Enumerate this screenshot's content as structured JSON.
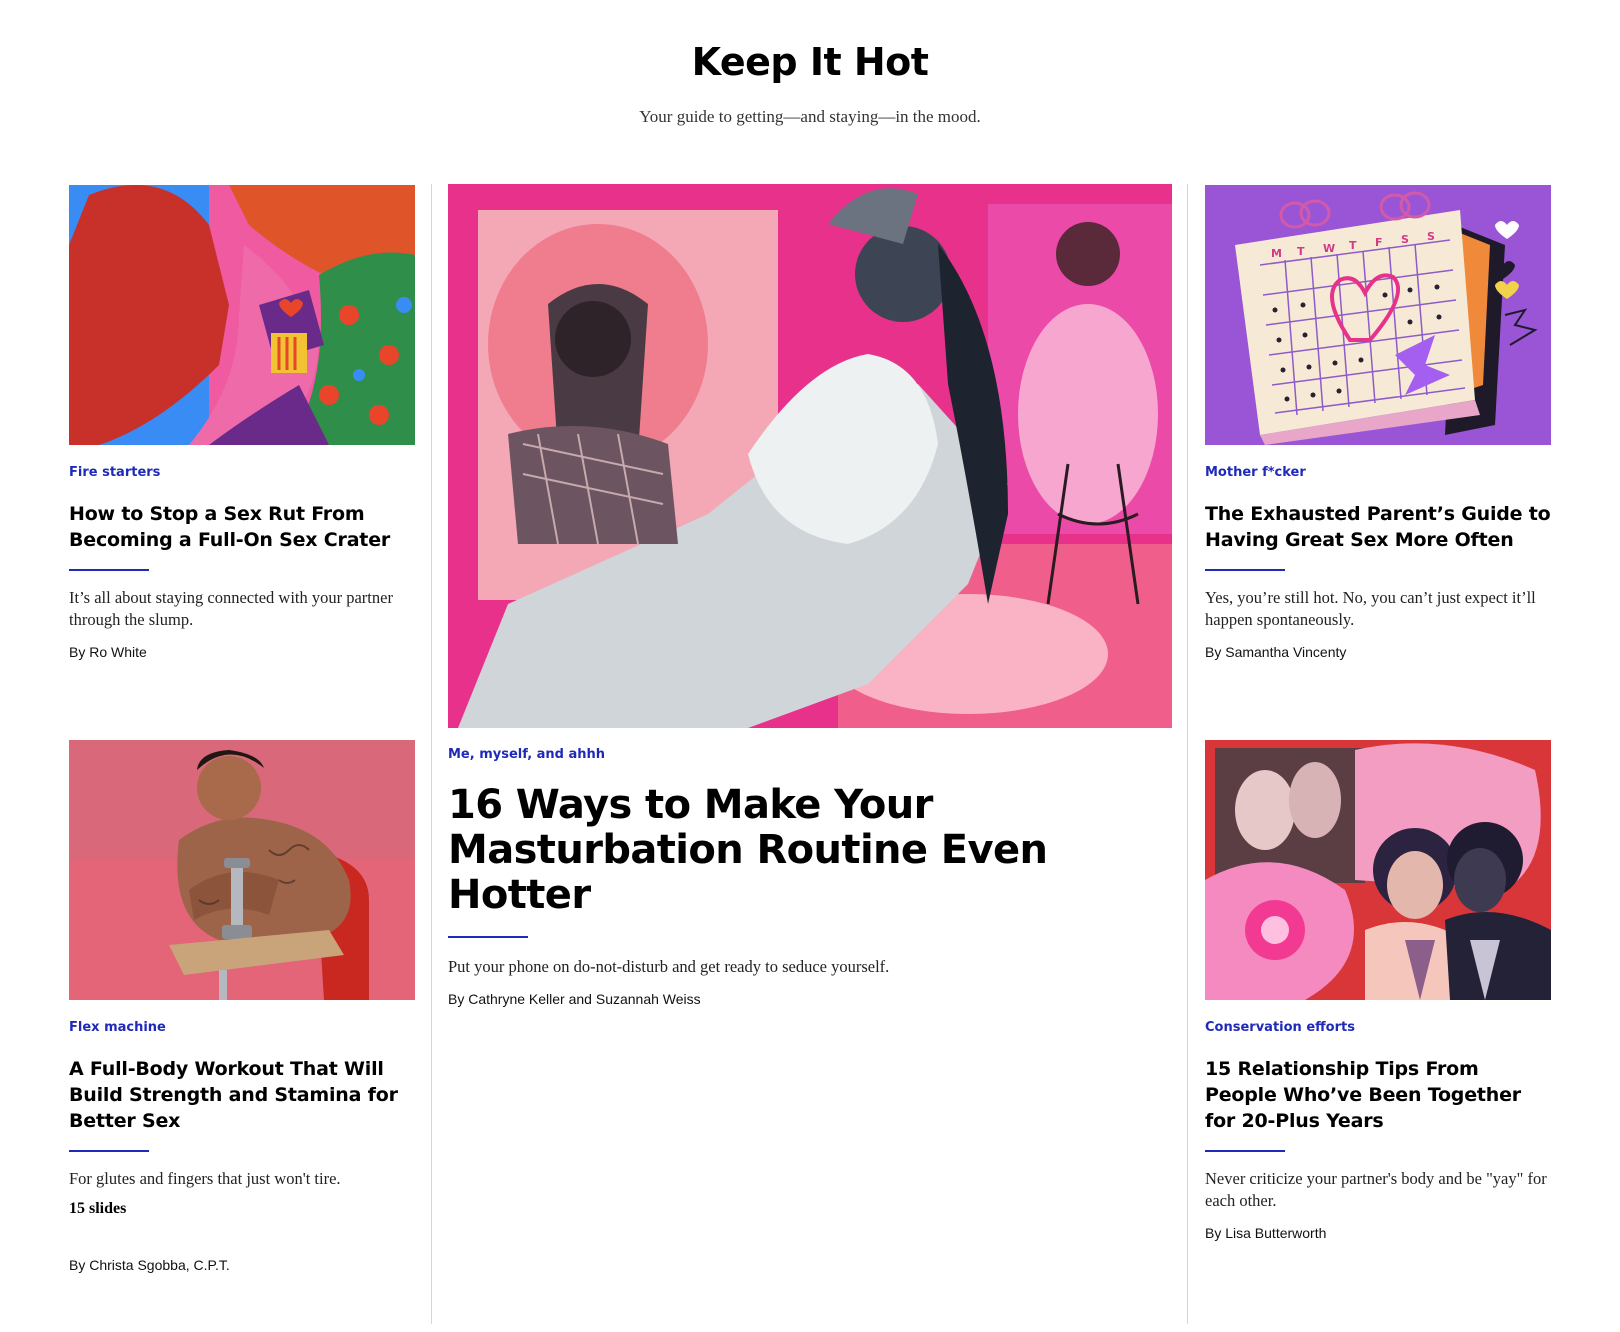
{
  "header": {
    "title": "Keep It Hot",
    "subtitle": "Your guide to getting—and staying—in the mood."
  },
  "cards": [
    {
      "rubric": "Fire starters",
      "headline": "How to Stop a Sex Rut From Becoming a Full-On Sex Crater",
      "dek": "It’s all about staying connected with your partner through the slump.",
      "byline": "By Ro White"
    },
    {
      "rubric": "Me, myself, and ahhh",
      "headline": "16 Ways to Make Your Masturbation Routine Even Hotter",
      "dek": "Put your phone on do-not-disturb and get ready to seduce yourself.",
      "byline": "By Cathryne Keller and Suzannah Weiss"
    },
    {
      "rubric": "Mother f*cker",
      "headline": "The Exhausted Parent’s Guide to Having Great Sex More Often",
      "dek": "Yes, you’re still hot. No, you can’t just expect it’ll happen spontaneously.",
      "byline": "By Samantha Vincenty"
    },
    {
      "rubric": "Flex machine",
      "headline": "A Full-Body Workout That Will Build Strength and Stamina for Better Sex",
      "dek": "For glutes and fingers that just won't tire.",
      "slides": "15 slides",
      "byline": "By Christa Sgobba, C.P.T."
    },
    {
      "rubric": "Conservation efforts",
      "headline": "15 Relationship Tips From People Who’ve Been Together for 20-Plus Years",
      "dek": "Never criticize your partner's body and be \"yay\" for each other.",
      "byline": "By Lisa Butterworth"
    }
  ],
  "calendar_days": [
    "M",
    "T",
    "W",
    "T",
    "F",
    "S",
    "S"
  ],
  "colors": {
    "accent": "#1f2bb8",
    "divider": "#d6d6d6",
    "hot_pink": "#e8318a",
    "purple": "#9a55d6"
  }
}
